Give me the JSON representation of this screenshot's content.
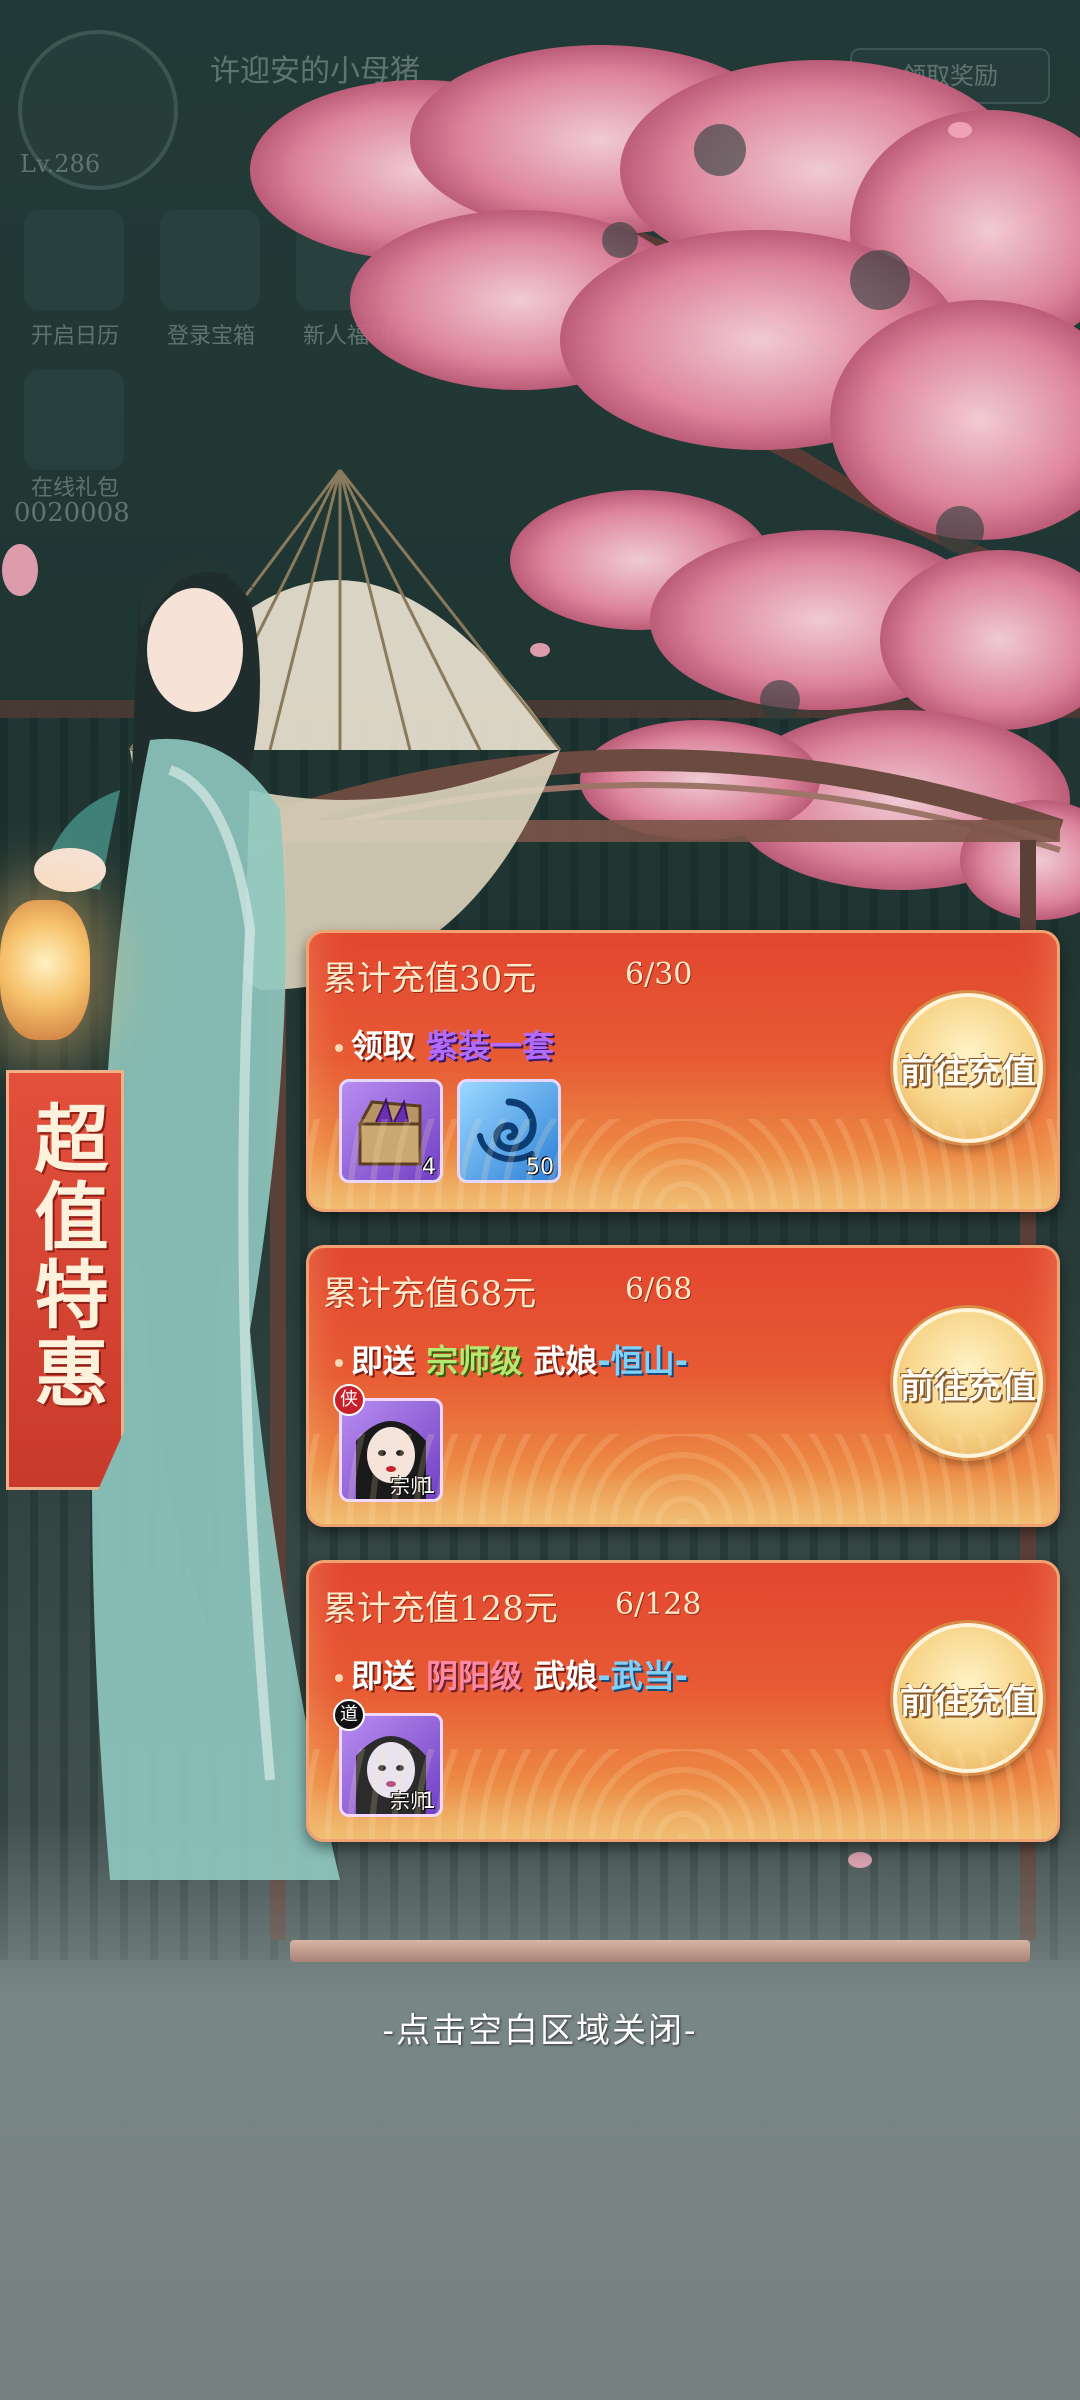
{
  "hud": {
    "player_name": "许迎安的小母猪",
    "level": "Lv.286",
    "top_button": "领取奖励",
    "icons": [
      {
        "label": "开启日历"
      },
      {
        "label": "登录宝箱"
      },
      {
        "label": "新人福利"
      },
      {
        "label": "在线礼包"
      }
    ],
    "score": "0020008"
  },
  "banner": {
    "text": "超值特惠"
  },
  "cards": [
    {
      "title": "累计充值30元",
      "progress": "6/30",
      "prefix": "领取",
      "reward_highlight": "紫装一套",
      "items": [
        {
          "icon": "chest-icon",
          "count": "4",
          "color": "#8a5bd6"
        },
        {
          "icon": "swirl-icon",
          "count": "50",
          "color": "#3f93e4"
        }
      ],
      "button": "前往充值"
    },
    {
      "title": "累计充值68元",
      "progress": "6/68",
      "prefix": "即送",
      "grade": "宗师级",
      "hero_label": "武娘",
      "hero_name": "恒山",
      "hero_count": "1",
      "hero_badge": "侠",
      "hero_tag": "宗师",
      "button": "前往充值"
    },
    {
      "title": "累计充值128元",
      "progress": "6/128",
      "prefix": "即送",
      "grade": "阴阳级",
      "hero_label": "武娘",
      "hero_name": "武当",
      "hero_count": "1",
      "hero_badge": "道",
      "hero_tag": "宗师",
      "button": "前往充值"
    }
  ],
  "close_hint": "-点击空白区域关闭-"
}
